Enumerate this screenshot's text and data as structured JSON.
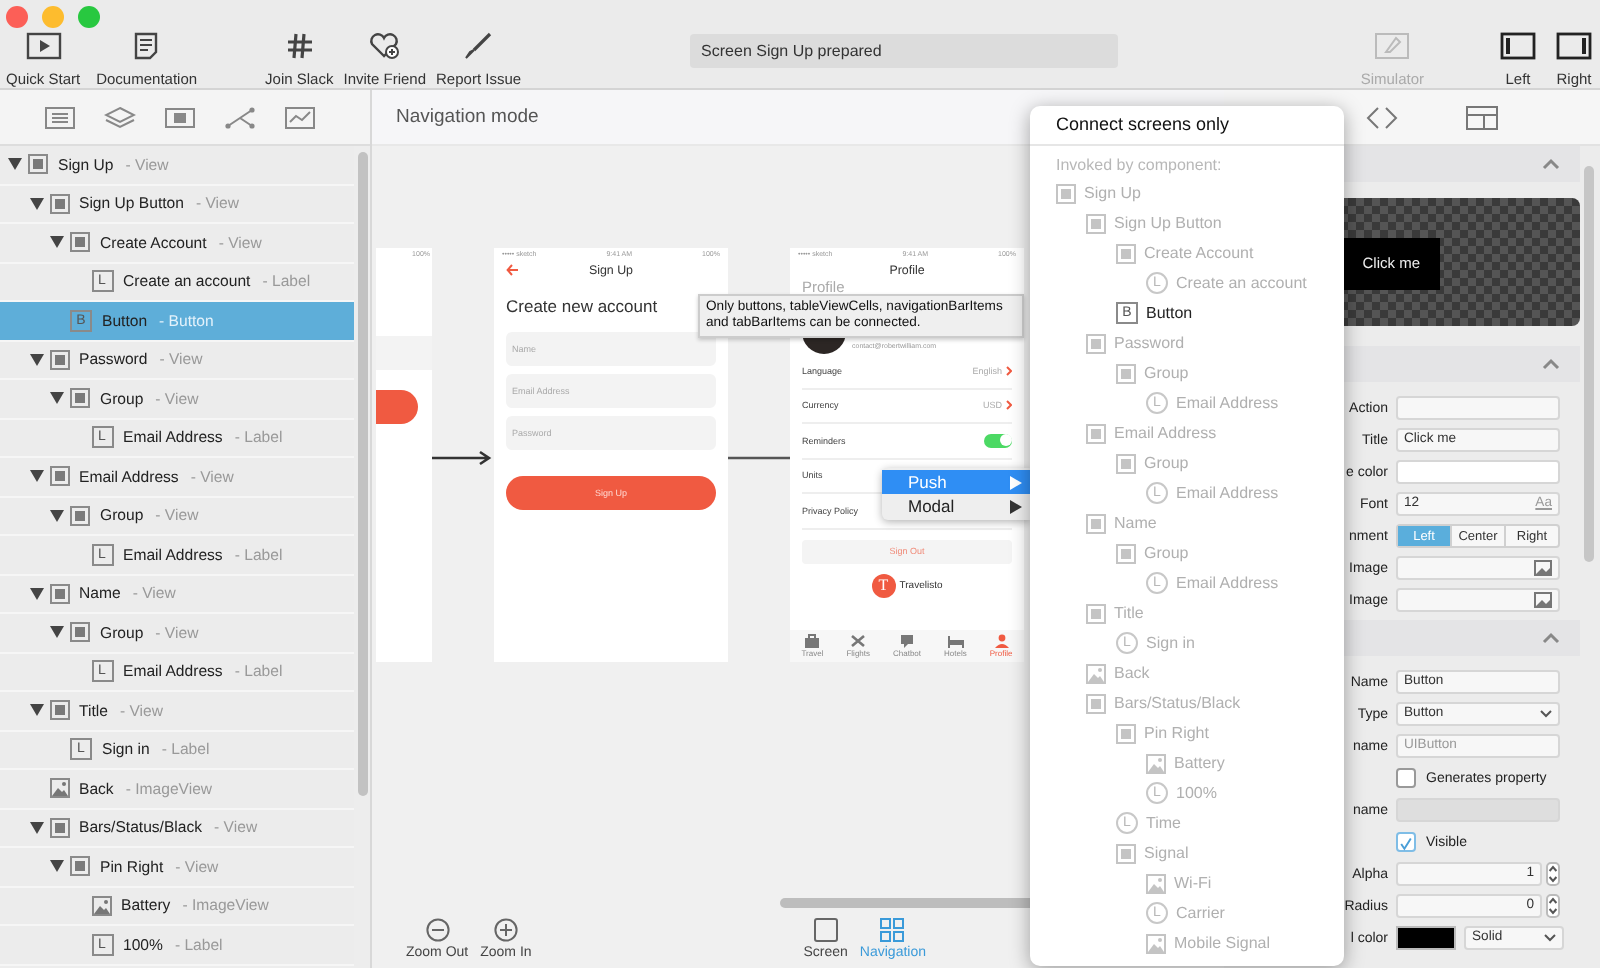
{
  "toolbar": {
    "left": [
      {
        "label": "Quick Start",
        "kind": "play"
      },
      {
        "label": "Documentation",
        "kind": "doc"
      }
    ],
    "middle": [
      {
        "label": "Join Slack",
        "kind": "hash"
      },
      {
        "label": "Invite Friend",
        "kind": "heart"
      },
      {
        "label": "Report Issue",
        "kind": "brush"
      }
    ],
    "status": "Screen Sign Up prepared",
    "right": [
      {
        "label": "Simulator",
        "kind": "eraser",
        "disabled": true
      },
      {
        "label": "Left",
        "kind": "panel-left",
        "disabled": false
      },
      {
        "label": "Right",
        "kind": "panel-right",
        "disabled": false
      }
    ]
  },
  "sidebar": {
    "tabs": [
      {
        "kind": "list"
      },
      {
        "kind": "layers"
      },
      {
        "kind": "columns"
      },
      {
        "kind": "graph"
      },
      {
        "kind": "chart"
      }
    ],
    "tree": [
      {
        "name": "Sign Up",
        "type": "- View",
        "kind": "view",
        "selected": false,
        "expanded": true,
        "children": [
          {
            "name": "Sign Up Button",
            "type": "- View",
            "kind": "view",
            "selected": false,
            "expanded": true,
            "children": [
              {
                "name": "Create Account",
                "type": "- View",
                "kind": "view",
                "selected": false,
                "expanded": true,
                "children": [
                  {
                    "name": "Create an account",
                    "type": "- Label",
                    "kind": "letter",
                    "badge": "L",
                    "selected": false
                  }
                ]
              },
              {
                "name": "Button",
                "type": "- Button",
                "kind": "letter",
                "badge": "B",
                "selected": true
              }
            ]
          },
          {
            "name": "Password",
            "type": "- View",
            "kind": "view",
            "selected": false,
            "expanded": true,
            "children": [
              {
                "name": "Group",
                "type": "- View",
                "kind": "view",
                "selected": false,
                "expanded": true,
                "children": [
                  {
                    "name": "Email Address",
                    "type": "- Label",
                    "kind": "letter",
                    "badge": "L",
                    "selected": false
                  }
                ]
              }
            ]
          },
          {
            "name": "Email Address",
            "type": "- View",
            "kind": "view",
            "selected": false,
            "expanded": true,
            "children": [
              {
                "name": "Group",
                "type": "- View",
                "kind": "view",
                "selected": false,
                "expanded": true,
                "children": [
                  {
                    "name": "Email Address",
                    "type": "- Label",
                    "kind": "letter",
                    "badge": "L",
                    "selected": false
                  }
                ]
              }
            ]
          },
          {
            "name": "Name",
            "type": "- View",
            "kind": "view",
            "selected": false,
            "expanded": true,
            "children": [
              {
                "name": "Group",
                "type": "- View",
                "kind": "view",
                "selected": false,
                "expanded": true,
                "children": [
                  {
                    "name": "Email Address",
                    "type": "- Label",
                    "kind": "letter",
                    "badge": "L",
                    "selected": false
                  }
                ]
              }
            ]
          },
          {
            "name": "Title",
            "type": "- View",
            "kind": "view",
            "selected": false,
            "expanded": true,
            "children": [
              {
                "name": "Sign in",
                "type": "- Label",
                "kind": "letter",
                "badge": "L",
                "selected": false
              }
            ]
          },
          {
            "name": "Back",
            "type": "- ImageView",
            "kind": "image",
            "selected": false
          },
          {
            "name": "Bars/Status/Black",
            "type": "- View",
            "kind": "view",
            "selected": false,
            "expanded": true,
            "children": [
              {
                "name": "Pin Right",
                "type": "- View",
                "kind": "view",
                "selected": false,
                "expanded": true,
                "children": [
                  {
                    "name": "Battery",
                    "type": "- ImageView",
                    "kind": "image",
                    "selected": false
                  },
                  {
                    "name": "100%",
                    "type": "- Label",
                    "kind": "letter",
                    "badge": "L",
                    "selected": false
                  }
                ]
              }
            ]
          }
        ]
      }
    ]
  },
  "canvas": {
    "title": "Navigation mode",
    "screens": [
      {
        "kind": "partial",
        "battery": "100%"
      },
      {
        "kind": "form",
        "carrier": "••••• sketch",
        "time": "9:41 AM",
        "battery": "100%",
        "title": "Sign Up",
        "heading": "Create new account",
        "fields": [
          "Name",
          "Email Address",
          "Password"
        ],
        "button": "Sign Up"
      },
      {
        "kind": "profile",
        "carrier": "••••• sketch",
        "time": "9:41 AM",
        "battery": "100%",
        "title": "Profile",
        "heading": "Profile",
        "email": "contact@robertwilliam.com",
        "rows": [
          {
            "label": "Language",
            "kind": "link",
            "value": "English"
          },
          {
            "label": "Currency",
            "kind": "link",
            "value": "USD"
          },
          {
            "label": "Reminders",
            "kind": "toggle",
            "on": true
          },
          {
            "label": "Units",
            "kind": "plain"
          },
          {
            "label": "Privacy Policy",
            "kind": "link"
          }
        ],
        "button": "Sign Out",
        "brand": "Travelisto",
        "brand_letter": "T",
        "tabs": [
          {
            "label": "Travel",
            "kind": "bag",
            "selected": false
          },
          {
            "label": "Flights",
            "kind": "plane",
            "selected": false
          },
          {
            "label": "Chatbot",
            "kind": "chat",
            "selected": false
          },
          {
            "label": "Hotels",
            "kind": "bed",
            "selected": false
          },
          {
            "label": "Profile",
            "kind": "person",
            "selected": true
          }
        ]
      }
    ],
    "tooltip": "Only buttons, tableViewCells, navigationBarItems and tabBarItems can be connected.",
    "menu": [
      {
        "label": "Push",
        "selected": true
      },
      {
        "label": "Modal",
        "selected": false
      }
    ],
    "zoom": [
      {
        "label": "Zoom Out",
        "kind": "minus"
      },
      {
        "label": "Zoom In",
        "kind": "plus"
      }
    ],
    "modes": [
      {
        "label": "Screen",
        "kind": "screen",
        "selected": false
      },
      {
        "label": "Navigation",
        "kind": "grid",
        "selected": true
      }
    ]
  },
  "dropdown": {
    "header": "Connect screens only",
    "section": "Invoked by component:",
    "items": [
      {
        "name": "Sign Up",
        "kind": "view",
        "disabled": true,
        "children": [
          {
            "name": "Sign Up Button",
            "kind": "view",
            "disabled": true,
            "children": [
              {
                "name": "Create Account",
                "kind": "view",
                "disabled": true,
                "children": [
                  {
                    "name": "Create an account",
                    "kind": "letter",
                    "badge": "L",
                    "disabled": true
                  }
                ]
              },
              {
                "name": "Button",
                "kind": "letter",
                "badge": "B",
                "disabled": false
              }
            ]
          },
          {
            "name": "Password",
            "kind": "view",
            "disabled": true,
            "children": [
              {
                "name": "Group",
                "kind": "view",
                "disabled": true,
                "children": [
                  {
                    "name": "Email Address",
                    "kind": "letter",
                    "badge": "L",
                    "disabled": true
                  }
                ]
              }
            ]
          },
          {
            "name": "Email Address",
            "kind": "view",
            "disabled": true,
            "children": [
              {
                "name": "Group",
                "kind": "view",
                "disabled": true,
                "children": [
                  {
                    "name": "Email Address",
                    "kind": "letter",
                    "badge": "L",
                    "disabled": true
                  }
                ]
              }
            ]
          },
          {
            "name": "Name",
            "kind": "view",
            "disabled": true,
            "children": [
              {
                "name": "Group",
                "kind": "view",
                "disabled": true,
                "children": [
                  {
                    "name": "Email Address",
                    "kind": "letter",
                    "badge": "L",
                    "disabled": true
                  }
                ]
              }
            ]
          },
          {
            "name": "Title",
            "kind": "view",
            "disabled": true,
            "children": [
              {
                "name": "Sign in",
                "kind": "letter",
                "badge": "L",
                "disabled": true
              }
            ]
          },
          {
            "name": "Back",
            "kind": "image",
            "disabled": true
          },
          {
            "name": "Bars/Status/Black",
            "kind": "view",
            "disabled": true,
            "children": [
              {
                "name": "Pin Right",
                "kind": "view",
                "disabled": true,
                "children": [
                  {
                    "name": "Battery",
                    "kind": "image",
                    "disabled": true
                  },
                  {
                    "name": "100%",
                    "kind": "letter",
                    "badge": "L",
                    "disabled": true
                  }
                ]
              },
              {
                "name": "Time",
                "kind": "letter",
                "badge": "L",
                "disabled": true
              },
              {
                "name": "Signal",
                "kind": "view",
                "disabled": true,
                "children": [
                  {
                    "name": "Wi-Fi",
                    "kind": "image",
                    "disabled": true
                  },
                  {
                    "name": "Carrier",
                    "kind": "letter",
                    "badge": "L",
                    "disabled": true
                  },
                  {
                    "name": "Mobile Signal",
                    "kind": "image",
                    "disabled": true
                  }
                ]
              }
            ]
          }
        ]
      }
    ]
  },
  "inspector": {
    "preview_label": "Click me",
    "sections": [
      [
        {
          "label": "Action",
          "kind": "text",
          "disabled": false
        },
        {
          "label": "Title",
          "kind": "text",
          "value": "Click me",
          "disabled": false
        },
        {
          "label": "e color",
          "kind": "color"
        },
        {
          "label": "Font",
          "kind": "font",
          "value": "12",
          "suffix": "Aa"
        },
        {
          "label": "nment",
          "kind": "segmented",
          "options": [
            {
              "label": "Left",
              "selected": true
            },
            {
              "label": "Center",
              "selected": false
            },
            {
              "label": "Right",
              "selected": false
            }
          ]
        },
        {
          "label": "Image",
          "kind": "image"
        },
        {
          "label": "Image",
          "kind": "image"
        }
      ],
      [
        {
          "label": "Name",
          "kind": "text",
          "value": "Button",
          "disabled": false
        },
        {
          "label": "Type",
          "kind": "select",
          "value": "Button"
        },
        {
          "label": "name",
          "kind": "text",
          "placeholder": "UIButton",
          "disabled": false
        },
        {
          "kind": "checkbox",
          "text": "Generates property",
          "checked": false
        },
        {
          "label": "name",
          "kind": "text",
          "disabled": true
        },
        {
          "kind": "checkbox",
          "text": "Visible",
          "checked": true
        },
        {
          "label": "Alpha",
          "kind": "stepper",
          "value": "1"
        },
        {
          "label": "Radius",
          "kind": "stepper",
          "value": "0"
        },
        {
          "label": "l color",
          "kind": "fill",
          "value": "Solid"
        }
      ]
    ]
  }
}
